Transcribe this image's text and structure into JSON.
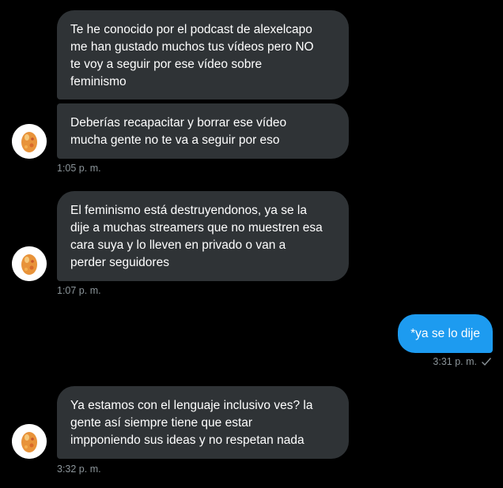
{
  "conversation": {
    "messages": [
      {
        "text": "Te he conocido por el podcast de alexelcapo\nme han gustado muchos tus vídeos pero NO\nte voy a seguir por ese vídeo sobre\nfeminismo"
      },
      {
        "text": "Deberías recapacitar y borrar ese vídeo\nmucha gente no te va a seguir por eso",
        "time": "1:05 p. m."
      },
      {
        "text": "El feminismo está destruyendonos, ya se la\ndije a muchas streamers que no muestren esa\ncara suya y lo lleven en privado o van a\nperder seguidores",
        "time": "1:07 p. m."
      },
      {
        "text": "*ya se lo dije",
        "time": "3:31 p. m."
      },
      {
        "text": "Ya estamos con el lenguaje inclusivo ves? la\ngente así siempre tiene que estar\nimpponiendo sus ideas y no respetan nada",
        "time": "3:32 p. m."
      }
    ]
  },
  "colors": {
    "background": "#000000",
    "incoming_bubble": "#2f3336",
    "outgoing_bubble": "#1d9bf0",
    "timestamp": "#8b9499"
  },
  "icons": {
    "avatar": "egg-avatar-icon",
    "read_receipt": "checkmark-icon"
  }
}
